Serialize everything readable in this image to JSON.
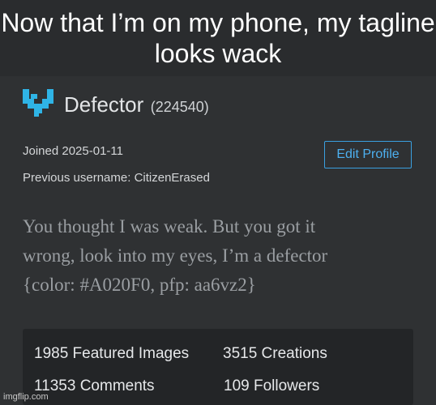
{
  "caption": "Now that I’m on my phone, my tagline looks wack",
  "profile": {
    "username": "Defector",
    "user_id": "(224540)",
    "avatar_icon": "pixel-y-avatar-icon",
    "avatar_color": "#2fb4e6",
    "joined": "Joined 2025-01-11",
    "previous_username": "Previous username: CitizenErased",
    "edit_button_label": "Edit Profile",
    "tagline_lines": [
      "You thought I was weak. But you got it",
      "wrong, look into my eyes, I’m a defector",
      "{color: #A020F0, pfp: aa6vz2}"
    ]
  },
  "stats": {
    "featured_images": "1985 Featured Images",
    "creations": "3515 Creations",
    "comments": "11353 Comments",
    "followers": "109 Followers"
  },
  "watermark": "imgflip.com"
}
